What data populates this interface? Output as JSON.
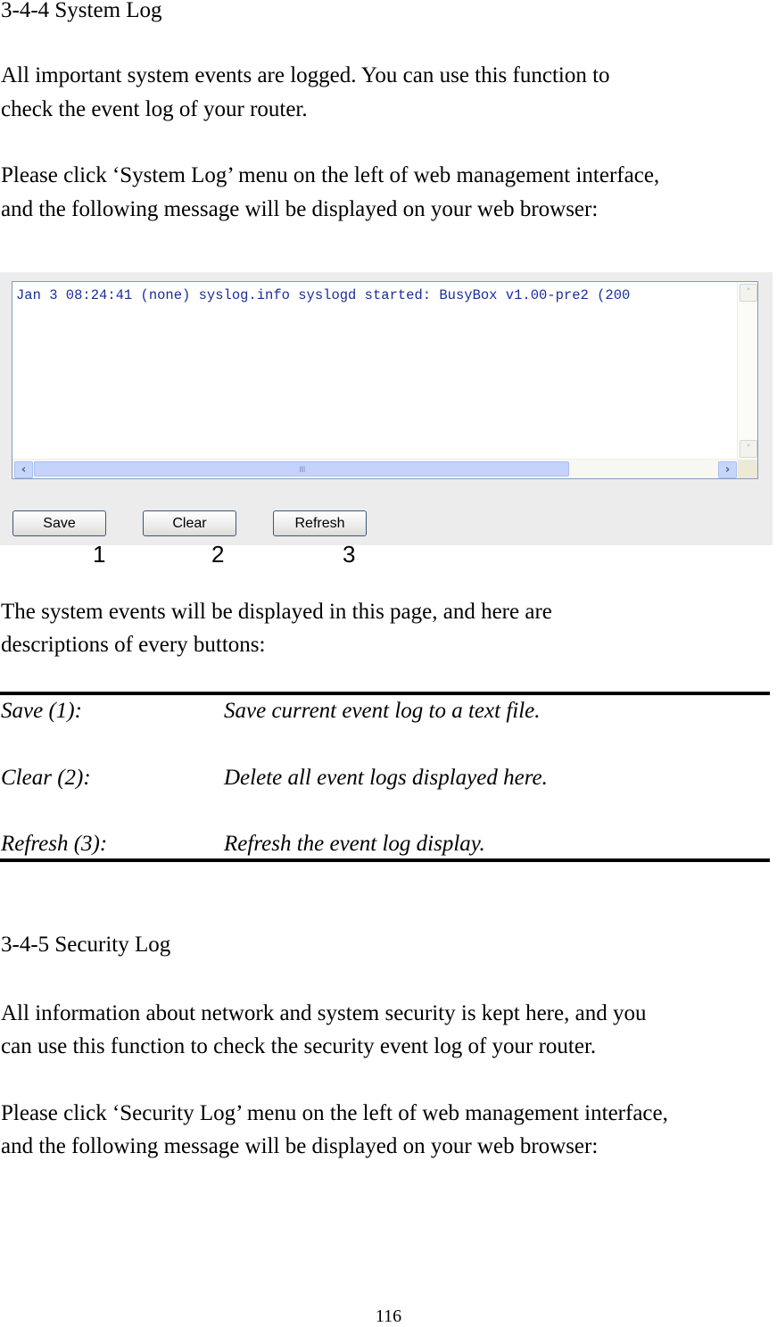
{
  "section1": {
    "heading": "3-4-4 System Log",
    "intro_lines": [
      "All important system events are logged. You can use this function to",
      "check the event log of your router."
    ],
    "instruction_lines": [
      "Please click ‘System Log’ menu on the left of web management interface,",
      "and the following message will be displayed on your web browser:"
    ]
  },
  "screenshot": {
    "log_entries": [
      "Jan  3 08:24:41 (none) syslog.info syslogd started: BusyBox v1.00-pre2 (200"
    ],
    "scroll_icons": {
      "up": "˄",
      "down": "˅",
      "left": "‹",
      "right": "›",
      "grip": "IIII"
    },
    "buttons": [
      {
        "label": "Save",
        "callout": "1"
      },
      {
        "label": "Clear",
        "callout": "2"
      },
      {
        "label": "Refresh",
        "callout": "3"
      }
    ]
  },
  "after_lines": [
    "The system events will be displayed in this page, and here are",
    "descriptions of every buttons:"
  ],
  "definitions": [
    {
      "term": "Save (1):",
      "description": "Save current event log to a text file."
    },
    {
      "term": "Clear (2):",
      "description": "Delete all event logs displayed here."
    },
    {
      "term": "Refresh (3):",
      "description": "Refresh the event log display."
    }
  ],
  "section2": {
    "heading": "3-4-5 Security Log",
    "intro_lines": [
      "All information about network and system security is kept here, and you",
      "can use this function to check the security event log of your router."
    ],
    "instruction_lines": [
      "Please click ‘Security Log’ menu on the left of web management interface,",
      "and the following message will be displayed on your web browser:"
    ]
  },
  "footer": {
    "page_number": "116"
  }
}
